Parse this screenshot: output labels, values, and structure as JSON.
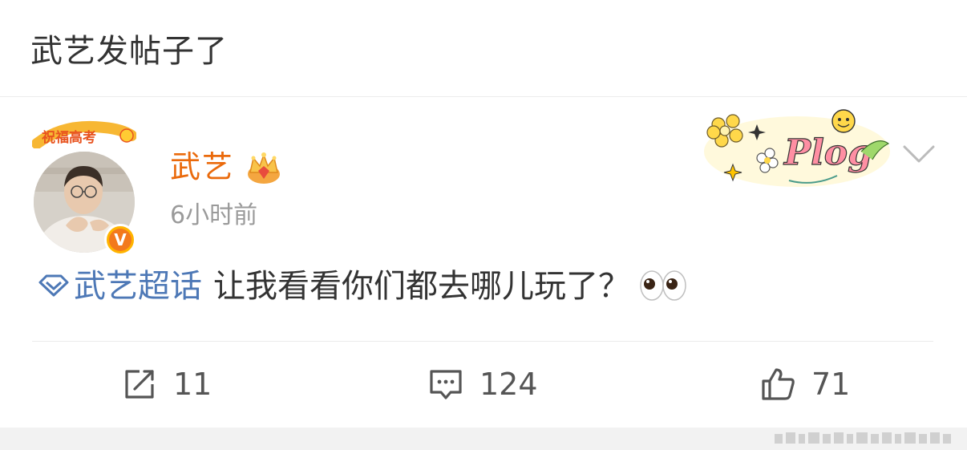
{
  "header": {
    "title": "武艺发帖子了"
  },
  "post": {
    "author": "武艺",
    "avatar_badge": "祝福高考",
    "verified_mark": "V",
    "timestamp": "6小时前",
    "sticker_text": "Plog",
    "topic": "武艺超话",
    "text": "让我看看你们都去哪儿玩了？",
    "emoji": "eyes"
  },
  "actions": {
    "repost": {
      "icon": "share-icon",
      "count": "11"
    },
    "comment": {
      "icon": "comment-icon",
      "count": "124"
    },
    "like": {
      "icon": "thumbs-up-icon",
      "count": "71"
    }
  },
  "colors": {
    "username": "#ea6a0c",
    "topic_link": "#4d78b6",
    "timestamp": "#9a9a9a",
    "text": "#333333"
  }
}
